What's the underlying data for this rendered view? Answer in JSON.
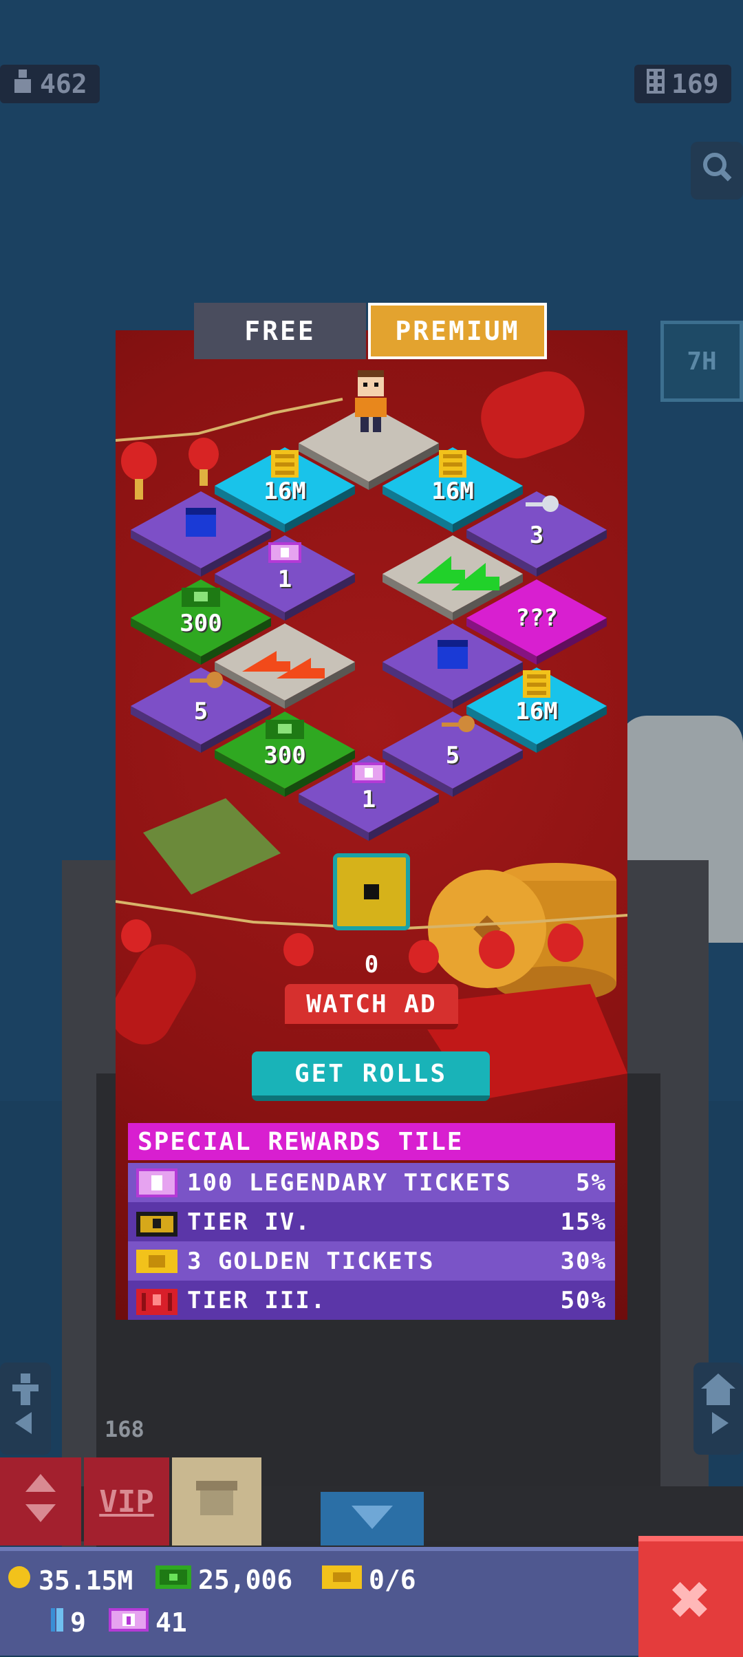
{
  "hud": {
    "population": "462",
    "floors": "169",
    "timer_label": "7H",
    "floor_number": "168"
  },
  "tabs": {
    "free": "FREE",
    "premium": "PREMIUM"
  },
  "tiles": [
    {
      "id": "start",
      "type": "start",
      "label": "",
      "color": "#c8c2b8"
    },
    {
      "id": "coins-a",
      "type": "coins",
      "label": "16M",
      "color": "#19c3ea"
    },
    {
      "id": "coins-b",
      "type": "coins",
      "label": "16M",
      "color": "#19c3ea"
    },
    {
      "id": "chest-a",
      "type": "chest",
      "label": "",
      "color": "#7d4fc7"
    },
    {
      "id": "ticket-a",
      "type": "legendary-ticket",
      "label": "1",
      "color": "#7d4fc7"
    },
    {
      "id": "arrow-a",
      "type": "green-arrows",
      "label": "",
      "color": "#c8c2b8"
    },
    {
      "id": "key-silver",
      "type": "silver-key",
      "label": "3",
      "color": "#7d4fc7"
    },
    {
      "id": "cash-a",
      "type": "cash",
      "label": "300",
      "color": "#2fa821"
    },
    {
      "id": "arrow-b",
      "type": "red-arrows",
      "label": "",
      "color": "#c8c2b8"
    },
    {
      "id": "chest-b",
      "type": "chest",
      "label": "",
      "color": "#7d4fc7"
    },
    {
      "id": "mystery",
      "type": "mystery",
      "label": "???",
      "color": "#d81fd0"
    },
    {
      "id": "key-bronze-a",
      "type": "bronze-key",
      "label": "5",
      "color": "#7d4fc7"
    },
    {
      "id": "cash-b",
      "type": "cash",
      "label": "300",
      "color": "#2fa821"
    },
    {
      "id": "key-bronze-b",
      "type": "bronze-key",
      "label": "5",
      "color": "#7d4fc7"
    },
    {
      "id": "coins-c",
      "type": "coins",
      "label": "16M",
      "color": "#19c3ea"
    },
    {
      "id": "ticket-b",
      "type": "legendary-ticket",
      "label": "1",
      "color": "#7d4fc7"
    }
  ],
  "rolls": {
    "count": "0",
    "watch_ad": "WATCH AD",
    "get_rolls": "GET ROLLS"
  },
  "rewards": {
    "title": "SPECIAL REWARDS TILE",
    "rows": [
      {
        "icon": "legendary-ticket-icon",
        "label": "100 LEGENDARY TICKETS",
        "pct": "5%",
        "bg": "#7a54c7"
      },
      {
        "icon": "tier-iv-chest-icon",
        "label": "TIER IV.",
        "pct": "15%",
        "bg": "#5b36a8"
      },
      {
        "icon": "golden-ticket-icon",
        "label": "3 GOLDEN TICKETS",
        "pct": "30%",
        "bg": "#7a54c7"
      },
      {
        "icon": "tier-iii-chest-icon",
        "label": "TIER III.",
        "pct": "50%",
        "bg": "#5b36a8"
      }
    ]
  },
  "toolbar": {
    "vip": "VIP"
  },
  "currency": {
    "coins": "35.15M",
    "bux": "25,006",
    "golden_tickets": "0/6",
    "keys": "9",
    "legendary_tickets": "41"
  },
  "colors": {
    "panel": "#8f1515",
    "premium": "#e3a32f",
    "watch_ad": "#d6302e",
    "get_rolls": "#19b3b8",
    "rewards_title": "#d81fd0",
    "close": "#e43c3c"
  }
}
